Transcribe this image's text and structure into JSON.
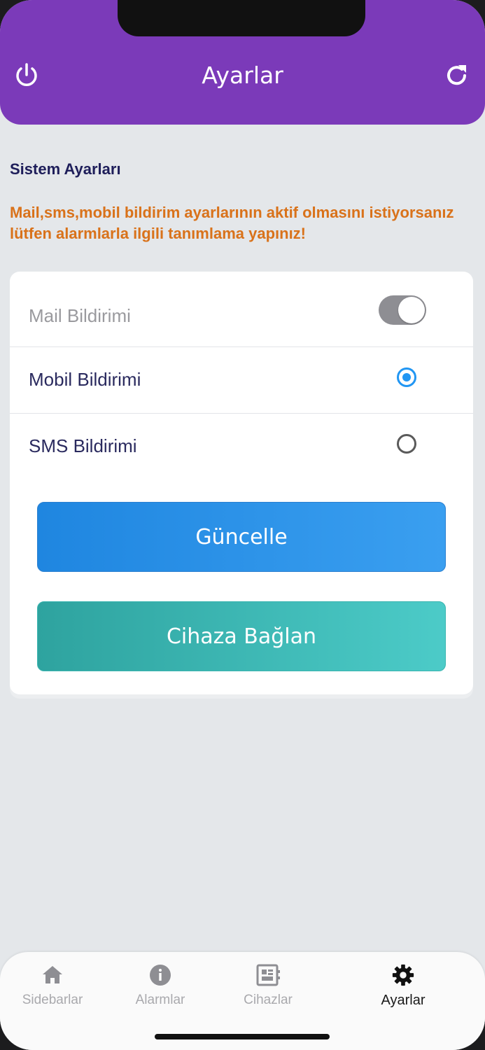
{
  "header": {
    "title": "Ayarlar",
    "left_icon": "power-icon",
    "right_icon": "refresh-icon",
    "color": "#7b3ab9"
  },
  "section": {
    "title": "Sistem Ayarları",
    "warning": "Mail,sms,mobil bildirim ayarlarının aktif olmasını istiyorsanız lütfen alarmlarla ilgili tanımlama yapınız!"
  },
  "settings": {
    "mail": {
      "label": "Mail Bildirimi",
      "enabled": true
    },
    "mobile": {
      "label": "Mobil Bildirimi",
      "selected": true
    },
    "sms": {
      "label": "SMS Bildirimi",
      "selected": false
    }
  },
  "buttons": {
    "update": "Güncelle",
    "connect": "Cihaza Bağlan"
  },
  "tabs": [
    {
      "label": "Sidebarlar",
      "icon": "home-icon"
    },
    {
      "label": "Alarmlar",
      "icon": "info-icon"
    },
    {
      "label": "Cihazlar",
      "icon": "device-icon"
    },
    {
      "label": "Ayarlar",
      "icon": "gear-icon",
      "active": true
    }
  ]
}
